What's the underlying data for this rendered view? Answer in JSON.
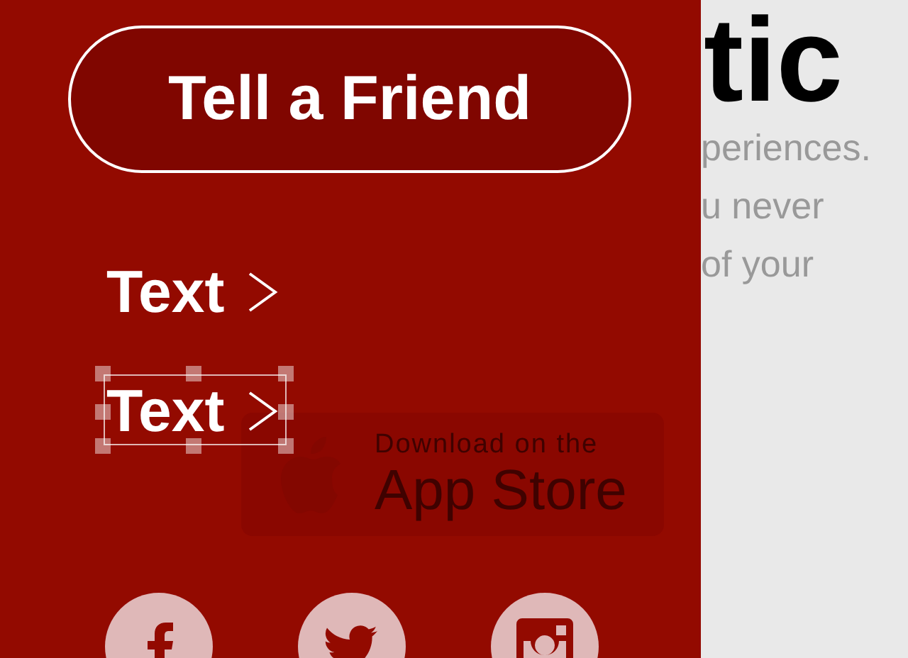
{
  "background_page": {
    "heading": "tic",
    "paragraph_lines": [
      "periences.",
      "u never",
      "of your"
    ]
  },
  "menu": {
    "button": "Tell a Friend",
    "links": [
      {
        "label": "Text",
        "selected": false
      },
      {
        "label": "Text",
        "selected": true
      }
    ],
    "app_store_badge": {
      "line_1": "Download on the",
      "line_2": "App Store"
    },
    "social": [
      {
        "kind": "facebook"
      },
      {
        "kind": "twitter"
      },
      {
        "kind": "instagram"
      }
    ]
  }
}
